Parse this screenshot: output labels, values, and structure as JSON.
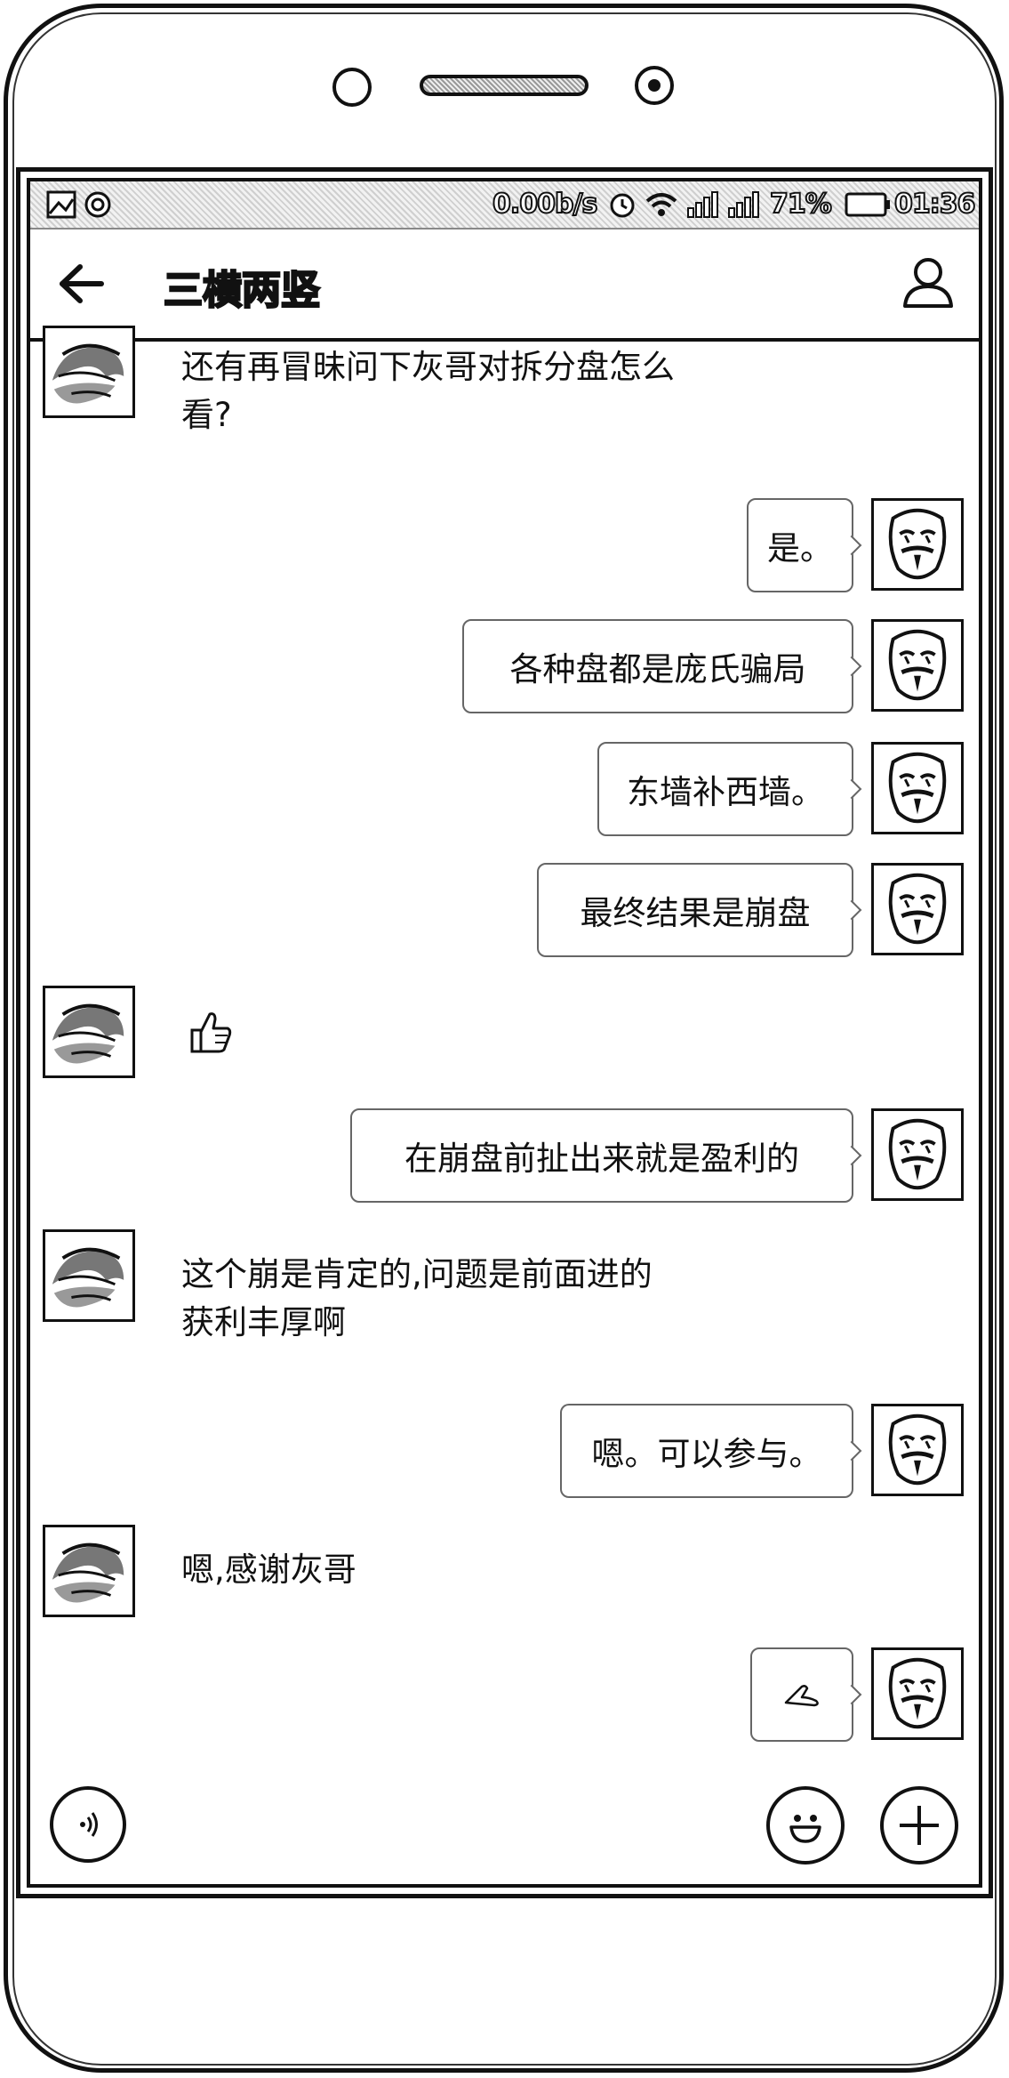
{
  "status_bar": {
    "net_speed": "0.00b/s",
    "battery": "71%",
    "time": "01:36",
    "icons": [
      "image-icon",
      "chat-icon",
      "alarm-icon",
      "wifi-icon",
      "signal-icon",
      "signal-icon",
      "battery-icon"
    ]
  },
  "header": {
    "back_icon": "arrow-left-icon",
    "title": "三横两竖",
    "profile_icon": "user-icon"
  },
  "messages": [
    {
      "side": "left",
      "type": "text",
      "lines": [
        "还有再冒昧问下灰哥对拆分盘怎么",
        "看?"
      ]
    },
    {
      "side": "right",
      "type": "text",
      "text": "是。"
    },
    {
      "side": "right",
      "type": "text",
      "text": "各种盘都是庞氏骗局"
    },
    {
      "side": "right",
      "type": "text",
      "text": "东墙补西墙。"
    },
    {
      "side": "right",
      "type": "text",
      "text": "最终结果是崩盘"
    },
    {
      "side": "left",
      "type": "emoji",
      "text": "👍"
    },
    {
      "side": "right",
      "type": "text",
      "text": "在崩盘前扯出来就是盈利的"
    },
    {
      "side": "left",
      "type": "text",
      "lines": [
        "这个崩是肯定的,问题是前面进的",
        "获利丰厚啊"
      ]
    },
    {
      "side": "right",
      "type": "text",
      "text": "嗯。可以参与。"
    },
    {
      "side": "left",
      "type": "text",
      "lines": [
        "嗯,感谢灰哥"
      ]
    },
    {
      "side": "right",
      "type": "emoji",
      "text": "fist-bump-icon"
    }
  ],
  "input_bar": {
    "voice_icon": "voice-icon",
    "emoji_icon": "smiley-icon",
    "add_icon": "plus-icon"
  }
}
